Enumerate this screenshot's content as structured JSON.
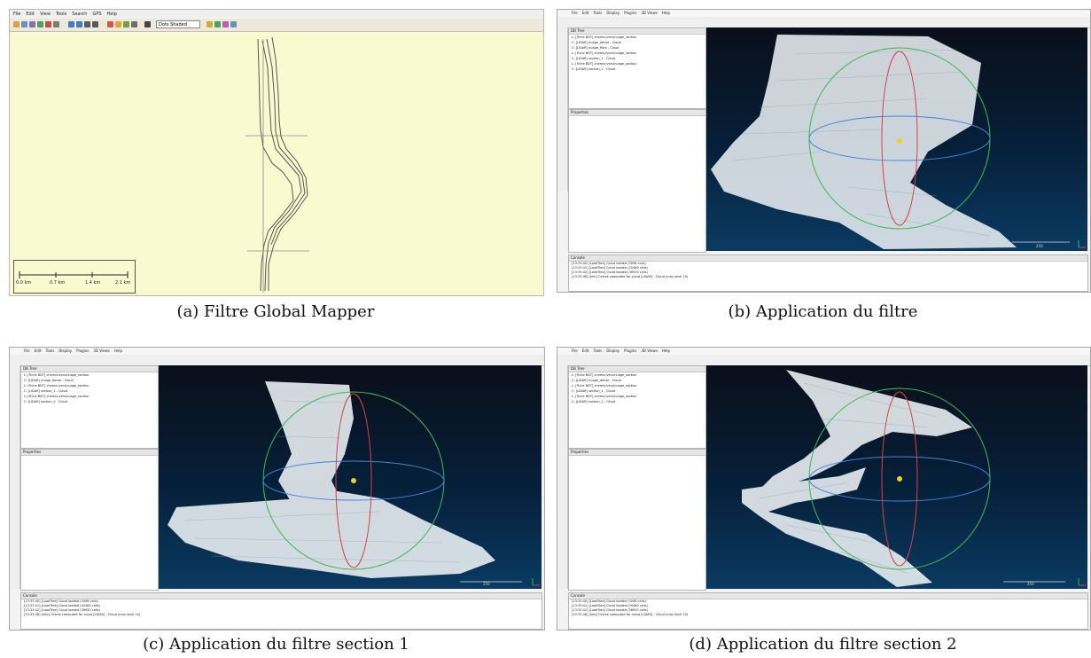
{
  "captions": {
    "a": "(a) Filtre Global Mapper",
    "b": "(b) Application du filtre",
    "c": "(c) Application du filtre section 1",
    "d": "(d) Application du filtre section 2"
  },
  "global_mapper": {
    "menu": [
      "File",
      "Edit",
      "View",
      "Tools",
      "Search",
      "GPS",
      "Help"
    ],
    "projection_combo": "Dots Shaded",
    "scale_labels": [
      "0.0 km",
      "0.7 km",
      "1.4 km",
      "2.1 km"
    ],
    "canvas_color": "#fafad0"
  },
  "cloudcompare": {
    "menu": [
      "File",
      "Edit",
      "Tools",
      "Display",
      "Plugins",
      "3D Views",
      "Help"
    ],
    "db_tree_title": "DB Tree",
    "properties_title": "Properties",
    "console_title": "Console",
    "background_top": "#0a0f1a",
    "background_bottom": "#0a3a62"
  },
  "panels": {
    "b": {
      "tree": [
        "L: [Fiche BDT] chemin/vers/nuage_section",
        "C: [LIDAR] nuage_dense - Cloud",
        "C: [LIDAR] nuage_filtre - Cloud",
        "L: [Fiche BDT] chemin/vers/nuage_section",
        "C: [LIDAR] section_1 - Cloud",
        "L: [Fiche BDT] chemin/vers/nuage_section",
        "C: [LIDAR] section_2 - Cloud"
      ],
      "console": [
        "[13:33:40] [LoadTree] Cloud loaded (3096 cells)",
        "[13:33:41] [LoadTree] Cloud loaded (20480 cells)",
        "[13:33:42] [LoadTree] Cloud loaded (36920 cells)",
        "[13:33:48] [Info] Octree computed for cloud [LIDAR] - Cloud (max level 10)"
      ],
      "scale": "250"
    },
    "c": {
      "tree": [
        "L: [Fiche BDT] chemin/vers/nuage_section",
        "C: [LIDAR] nuage_dense - Cloud",
        "L: [Fiche BDT] chemin/vers/nuage_section",
        "C: [LIDAR] section_1 - Cloud",
        "L: [Fiche BDT] chemin/vers/nuage_section",
        "C: [LIDAR] section_2 - Cloud"
      ],
      "console": [
        "[13:33:40] [LoadTree] Cloud loaded (3096 cells)",
        "[13:33:41] [LoadTree] Cloud loaded (20480 cells)",
        "[13:33:42] [LoadTree] Cloud loaded (36920 cells)",
        "[13:33:48] [Info] Octree computed for cloud [LIDAR] - Cloud (max level 10)"
      ],
      "scale": "250"
    },
    "d": {
      "tree": [
        "L: [Fiche BDT] chemin/vers/nuage_section",
        "C: [LIDAR] nuage_dense - Cloud",
        "L: [Fiche BDT] chemin/vers/nuage_section",
        "C: [LIDAR] section_1 - Cloud",
        "L: [Fiche BDT] chemin/vers/nuage_section",
        "C: [LIDAR] section_2 - Cloud"
      ],
      "console": [
        "[13:33:40] [LoadTree] Cloud loaded (3096 cells)",
        "[13:33:41] [LoadTree] Cloud loaded (20480 cells)",
        "[13:33:42] [LoadTree] Cloud loaded (36920 cells)",
        "[13:33:48] [Info] Octree computed for cloud [LIDAR] - Cloud (max level 10)"
      ],
      "scale": "250"
    }
  }
}
